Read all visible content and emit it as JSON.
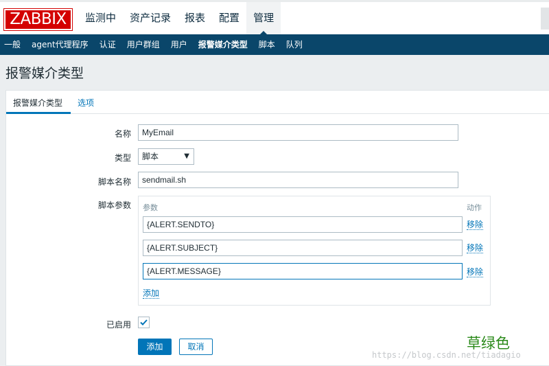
{
  "logo": "ZABBIX",
  "main_menu": [
    "监测中",
    "资产记录",
    "报表",
    "配置",
    "管理"
  ],
  "sub_menu": [
    "一般",
    "agent代理程序",
    "认证",
    "用户群组",
    "用户",
    "报警媒介类型",
    "脚本",
    "队列"
  ],
  "page_title": "报警媒介类型",
  "tabs": [
    "报警媒介类型",
    "选项"
  ],
  "form": {
    "name_label": "名称",
    "name_value": "MyEmail",
    "type_label": "类型",
    "type_value": "脚本",
    "script_name_label": "脚本名称",
    "script_name_value": "sendmail.sh",
    "params_label": "脚本参数",
    "params_col_param": "参数",
    "params_col_action": "动作",
    "params": [
      {
        "value": "{ALERT.SENDTO}",
        "remove": "移除"
      },
      {
        "value": "{ALERT.SUBJECT}",
        "remove": "移除"
      },
      {
        "value": "{ALERT.MESSAGE}",
        "remove": "移除"
      }
    ],
    "add_param": "添加",
    "enabled_label": "已启用",
    "enabled": true,
    "add_button": "添加",
    "cancel_button": "取消"
  },
  "watermark": {
    "text": "草绿色",
    "url": "https://blog.csdn.net/tiadagio"
  },
  "colors": {
    "brand_red": "#d40000",
    "nav_blue": "#0a466a",
    "accent_blue": "#0275b8",
    "watermark_green": "#2b8a1a"
  }
}
